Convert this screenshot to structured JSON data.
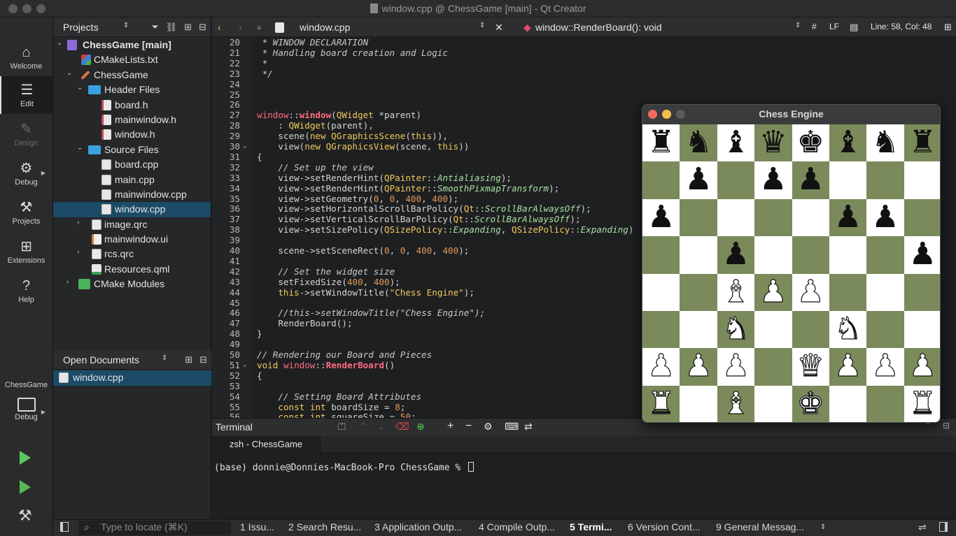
{
  "window": {
    "title": "window.cpp @ ChessGame [main] - Qt Creator"
  },
  "modebar": {
    "items": [
      {
        "label": "Welcome",
        "icon": "home-icon",
        "glyph": "⌂"
      },
      {
        "label": "Edit",
        "icon": "edit-icon",
        "glyph": "☰"
      },
      {
        "label": "Design",
        "icon": "design-icon",
        "glyph": "✎"
      },
      {
        "label": "Debug",
        "icon": "bug-icon",
        "glyph": "⚙"
      },
      {
        "label": "Projects",
        "icon": "wrench-icon",
        "glyph": "⚒"
      },
      {
        "label": "Extensions",
        "icon": "extensions-icon",
        "glyph": "⊞"
      },
      {
        "label": "Help",
        "icon": "help-icon",
        "glyph": "?"
      }
    ],
    "kit_label": "ChessGame",
    "kit_mode": "Debug"
  },
  "projects_panel": {
    "header": "Projects",
    "tree": [
      {
        "label": "ChessGame [main]",
        "bold": true
      },
      {
        "label": "CMakeLists.txt"
      },
      {
        "label": "ChessGame"
      },
      {
        "label": "Header Files"
      },
      {
        "label": "board.h"
      },
      {
        "label": "mainwindow.h"
      },
      {
        "label": "window.h"
      },
      {
        "label": "Source Files"
      },
      {
        "label": "board.cpp"
      },
      {
        "label": "main.cpp"
      },
      {
        "label": "mainwindow.cpp"
      },
      {
        "label": "window.cpp",
        "selected": true
      },
      {
        "label": "image.qrc"
      },
      {
        "label": "mainwindow.ui"
      },
      {
        "label": "rcs.qrc"
      },
      {
        "label": "Resources.qml"
      },
      {
        "label": "CMake Modules"
      }
    ]
  },
  "open_documents": {
    "header": "Open Documents",
    "items": [
      "window.cpp"
    ]
  },
  "editor_toolbar": {
    "file": "window.cpp",
    "symbol": "window::RenderBoard(): void",
    "hash": "#",
    "line_ending": "LF",
    "position": "Line: 58, Col: 48"
  },
  "editor": {
    "lines": [
      {
        "n": "20",
        "text": " * WINDOW DECLARATION"
      },
      {
        "n": "21",
        "text": " * Handling board creation and Logic"
      },
      {
        "n": "22",
        "text": " *"
      },
      {
        "n": "23",
        "text": " */"
      },
      {
        "n": "24",
        "text": ""
      },
      {
        "n": "25",
        "text": ""
      },
      {
        "n": "26",
        "text": ""
      },
      {
        "n": "27",
        "text": "window::window(QWidget *parent)"
      },
      {
        "n": "28",
        "text": "    : QWidget(parent),"
      },
      {
        "n": "29",
        "text": "    scene(new QGraphicsScene(this)),"
      },
      {
        "n": "30",
        "text": "    view(new QGraphicsView(scene, this))"
      },
      {
        "n": "31",
        "text": "{"
      },
      {
        "n": "32",
        "text": "    // Set up the view"
      },
      {
        "n": "33",
        "text": "    view->setRenderHint(QPainter::Antialiasing);"
      },
      {
        "n": "34",
        "text": "    view->setRenderHint(QPainter::SmoothPixmapTransform);"
      },
      {
        "n": "35",
        "text": "    view->setGeometry(0, 0, 400, 400);"
      },
      {
        "n": "36",
        "text": "    view->setHorizontalScrollBarPolicy(Qt::ScrollBarAlwaysOff);"
      },
      {
        "n": "37",
        "text": "    view->setVerticalScrollBarPolicy(Qt::ScrollBarAlwaysOff);"
      },
      {
        "n": "38",
        "text": "    view->setSizePolicy(QSizePolicy::Expanding, QSizePolicy::Expanding)"
      },
      {
        "n": "39",
        "text": ""
      },
      {
        "n": "40",
        "text": "    scene->setSceneRect(0, 0, 400, 400);"
      },
      {
        "n": "41",
        "text": ""
      },
      {
        "n": "42",
        "text": "    // Set the widget size"
      },
      {
        "n": "43",
        "text": "    setFixedSize(400, 400);"
      },
      {
        "n": "44",
        "text": "    this->setWindowTitle(\"Chess Engine\");"
      },
      {
        "n": "45",
        "text": ""
      },
      {
        "n": "46",
        "text": "    //this->setWindowTitle(\"Chess Engine\");"
      },
      {
        "n": "47",
        "text": "    RenderBoard();"
      },
      {
        "n": "48",
        "text": "}"
      },
      {
        "n": "49",
        "text": ""
      },
      {
        "n": "50",
        "text": "// Rendering our Board and Pieces"
      },
      {
        "n": "51",
        "text": "void window::RenderBoard()"
      },
      {
        "n": "52",
        "text": "{"
      },
      {
        "n": "53",
        "text": ""
      },
      {
        "n": "54",
        "text": "    // Setting Board Attributes"
      },
      {
        "n": "55",
        "text": "    const int boardSize = 8;"
      },
      {
        "n": "56",
        "text": "    const int squareSize = 50;"
      }
    ]
  },
  "terminal": {
    "header": "Terminal",
    "tab": "zsh - ChessGame",
    "prompt": "(base) donnie@Donnies-MacBook-Pro ChessGame % "
  },
  "statusbar": {
    "locate_placeholder": "Type to locate (⌘K)",
    "panes": [
      "1  Issu...",
      "2  Search Resu...",
      "3  Application Outp...",
      "4  Compile Outp...",
      "5  Termi...",
      "6  Version Cont...",
      "9  General Messag..."
    ]
  },
  "chess": {
    "title": "Chess Engine",
    "board": [
      [
        "bR",
        "bN",
        "bB",
        "bQ",
        "bK",
        "bB",
        "bN",
        "bR"
      ],
      [
        "",
        "bP",
        "",
        "bP",
        "bP",
        "",
        "",
        ""
      ],
      [
        "bP",
        "",
        "",
        "",
        "",
        "bP",
        "bP",
        ""
      ],
      [
        "",
        "",
        "bP",
        "",
        "",
        "",
        "",
        "bP"
      ],
      [
        "",
        "",
        "wB",
        "wP",
        "wP",
        "",
        "",
        ""
      ],
      [
        "",
        "",
        "wN",
        "",
        "",
        "wN",
        "",
        ""
      ],
      [
        "wP",
        "wP",
        "wP",
        "",
        "wQ",
        "wP",
        "wP",
        "wP"
      ],
      [
        "wR",
        "",
        "wB",
        "",
        "wK",
        "",
        "",
        "wR"
      ]
    ]
  }
}
